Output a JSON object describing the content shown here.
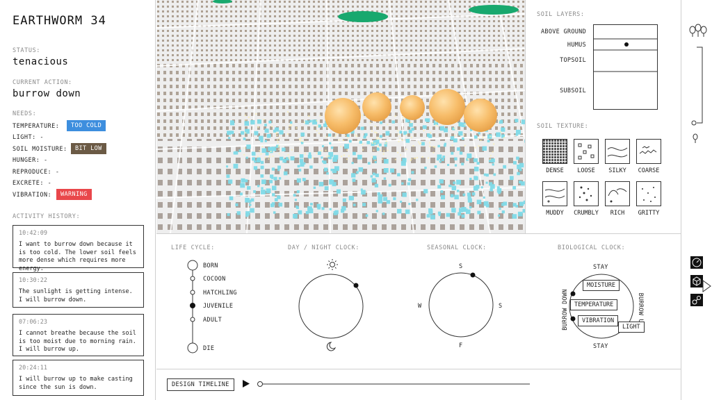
{
  "worm": {
    "name": "EARTHWORM 34",
    "status_label": "STATUS:",
    "status": "tenacious",
    "action_label": "CURRENT ACTION:",
    "action": "burrow down"
  },
  "needs": {
    "label": "NEEDS:",
    "items": [
      {
        "name": "TEMPERATURE:",
        "value": "TOO COLD",
        "color": "#3d8ede"
      },
      {
        "name": "LIGHT:",
        "value": "-"
      },
      {
        "name": "SOIL MOISTURE:",
        "value": "BIT LOW",
        "color": "#6b5a45"
      },
      {
        "name": "HUNGER:",
        "value": "-"
      },
      {
        "name": "REPRODUCE:",
        "value": "-"
      },
      {
        "name": "EXCRETE:",
        "value": "-"
      },
      {
        "name": "VIBRATION:",
        "value": "WARNING",
        "color": "#e9474b"
      }
    ]
  },
  "history": {
    "label": "ACTIVITY HISTORY:",
    "entries": [
      {
        "time": "10:42:09",
        "text": "I want to burrow down because it is too cold. The lower soil feels more dense which requires more energy."
      },
      {
        "time": "10:30:22",
        "text": "The sunlight is getting intense. I will burrow down."
      },
      {
        "time": "07:06:23",
        "text": "I cannot breathe because the soil is too moist due to morning rain. I will burrow up."
      },
      {
        "time": "20:24:11",
        "text": "I will burrow up to make casting since the sun is down."
      }
    ]
  },
  "soil_layers": {
    "label": "SOIL LAYERS:",
    "layers": [
      "ABOVE GROUND",
      "HUMUS",
      "TOPSOIL",
      "SUBSOIL"
    ],
    "current": "HUMUS"
  },
  "soil_texture": {
    "label": "SOIL TEXTURE:",
    "items": [
      "DENSE",
      "LOOSE",
      "SILKY",
      "COARSE",
      "MUDDY",
      "CRUMBLY",
      "RICH",
      "GRITTY"
    ],
    "selected": "DENSE"
  },
  "life_cycle": {
    "label": "LIFE CYCLE:",
    "stages": [
      "BORN",
      "COCOON",
      "HATCHLING",
      "JUVENILE",
      "ADULT",
      "DIE"
    ],
    "current": "JUVENILE"
  },
  "day_night": {
    "label": "DAY / NIGHT CLOCK:"
  },
  "seasonal": {
    "label": "SEASONAL CLOCK:",
    "n": "S",
    "e": "S",
    "s": "F",
    "w": "W"
  },
  "biological": {
    "label": "BIOLOGICAL CLOCK:",
    "top": "STAY",
    "bottom": "STAY",
    "left": "BURROW DOWN",
    "right": "BURROW UP",
    "factors": [
      "MOISTURE",
      "TEMPERATURE",
      "VIBRATION",
      "LIGHT"
    ]
  },
  "timeline": {
    "button": "DESIGN TIMELINE"
  },
  "colors": {
    "sphere": "#f7bd6a",
    "particle": "#7fdbe8",
    "green": "#18a86e"
  }
}
